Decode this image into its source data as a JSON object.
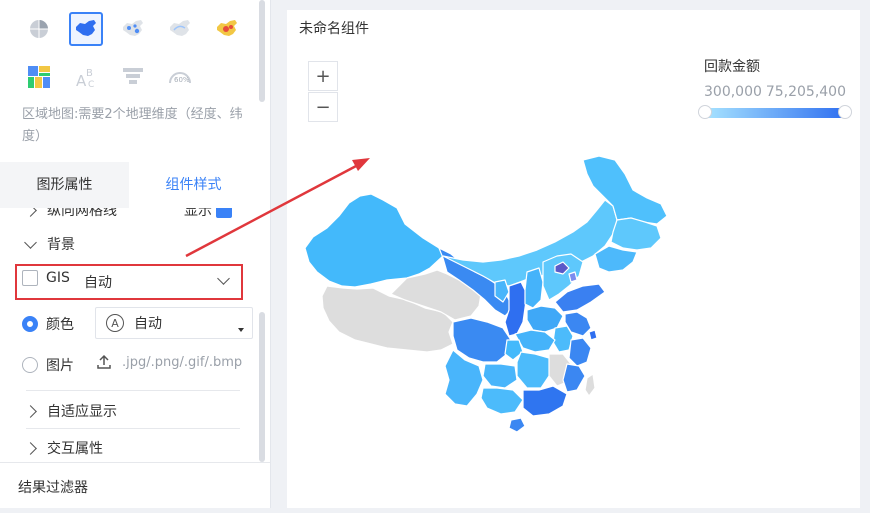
{
  "left_panel": {
    "chart_types": [
      {
        "name": "pie-chart-icon"
      },
      {
        "name": "china-region-map-icon",
        "selected": true
      },
      {
        "name": "point-map-icon"
      },
      {
        "name": "flow-map-icon"
      },
      {
        "name": "heat-map-icon"
      },
      {
        "name": "treemap-icon"
      },
      {
        "name": "word-cloud-icon"
      },
      {
        "name": "funnel-icon"
      },
      {
        "name": "gauge-icon",
        "text": "60%"
      }
    ],
    "hint": "区域地图:需要2个地理维度（经度、纬度）",
    "tabs": [
      {
        "label": "图形属性",
        "active": false
      },
      {
        "label": "组件样式",
        "active": true
      }
    ],
    "cut_row": {
      "label": "纵向网格线",
      "value": "显示"
    },
    "background_section": {
      "label": "背景"
    },
    "gis": {
      "label": "GIS",
      "value": "自动",
      "checked": false
    },
    "color_option": {
      "label": "颜色",
      "selected": true,
      "value": "自动",
      "badge": "A"
    },
    "image_option": {
      "label": "图片",
      "selected": false,
      "placeholder": ".jpg/.png/.gif/.bmp"
    },
    "adaptive_section": {
      "label": "自适应显示"
    },
    "interaction_section": {
      "label": "交互属性"
    },
    "result_filter": {
      "label": "结果过滤器"
    }
  },
  "main": {
    "widget_title": "未命名组件",
    "zoom_in": "+",
    "zoom_out": "−",
    "legend": {
      "title": "回款金额",
      "min": "300,000",
      "max": "75,205,400",
      "color_start": "#a8e4ff",
      "color_end": "#2f6ff0"
    }
  },
  "colors": {
    "accent": "#3a82f7",
    "annotation_red": "#e0373c",
    "no_data_gray": "#dddddd"
  }
}
